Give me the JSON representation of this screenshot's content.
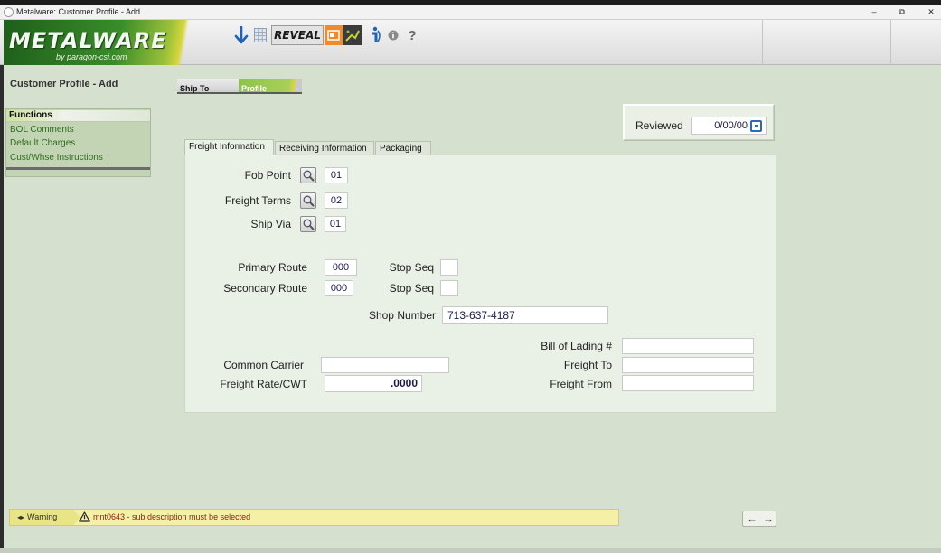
{
  "window": {
    "title": "Metalware: Customer Profile - Add",
    "controls": {
      "minimize": "–",
      "restore": "⧉",
      "close": "✕"
    }
  },
  "logo": {
    "main": "METALWARE",
    "sub": "by paragon-csi.com"
  },
  "toolbar": {
    "reveal_label": "REVEAL",
    "icons": [
      "download-arrow-icon",
      "grid-icon",
      "reveal-logo",
      "slides-icon",
      "film-icon",
      "info-i-icon",
      "info-circle-icon",
      "help-icon"
    ],
    "help_label": "?"
  },
  "page": {
    "title": "Customer Profile - Add"
  },
  "functions": {
    "header": "Functions",
    "items": [
      "BOL Comments",
      "Default Charges",
      "Cust/Whse Instructions"
    ]
  },
  "top_tabs": [
    {
      "label": "Ship To",
      "active": false
    },
    {
      "label": "Profile",
      "active": true
    }
  ],
  "reviewed": {
    "label": "Reviewed",
    "value": "0/00/00"
  },
  "tabs": [
    {
      "label": "Freight Information",
      "active": true
    },
    {
      "label": "Receiving Information",
      "active": false
    },
    {
      "label": "Packaging",
      "active": false
    }
  ],
  "freight": {
    "fob_point": {
      "label": "Fob Point",
      "value": "01"
    },
    "freight_terms": {
      "label": "Freight Terms",
      "value": "02"
    },
    "ship_via": {
      "label": "Ship Via",
      "value": "01"
    },
    "primary_route": {
      "label": "Primary Route",
      "value": "000"
    },
    "secondary_route": {
      "label": "Secondary Route",
      "value": "000"
    },
    "stop_seq_1": {
      "label": "Stop Seq",
      "value": ""
    },
    "stop_seq_2": {
      "label": "Stop Seq",
      "value": ""
    },
    "shop_number": {
      "label": "Shop Number",
      "value": "713-637-4187"
    },
    "bill_of_lading": {
      "label": "Bill of Lading #",
      "value": ""
    },
    "common_carrier": {
      "label": "Common Carrier",
      "value": ""
    },
    "freight_to": {
      "label": "Freight To",
      "value": ""
    },
    "freight_rate": {
      "label": "Freight Rate/CWT",
      "value": ".0000"
    },
    "freight_from": {
      "label": "Freight From",
      "value": ""
    }
  },
  "status": {
    "tag": "Warning",
    "message": "mnt0643 - sub description must be selected"
  },
  "nav": {
    "prev": "←",
    "next": "→"
  },
  "colors": {
    "background": "#d6e0cf",
    "panel": "#e9f0e6",
    "function_link": "#2c6e1a",
    "warning_bg": "#f4f1a6",
    "warning_text": "#8b1d12",
    "active_tab": "#8dc34a"
  }
}
